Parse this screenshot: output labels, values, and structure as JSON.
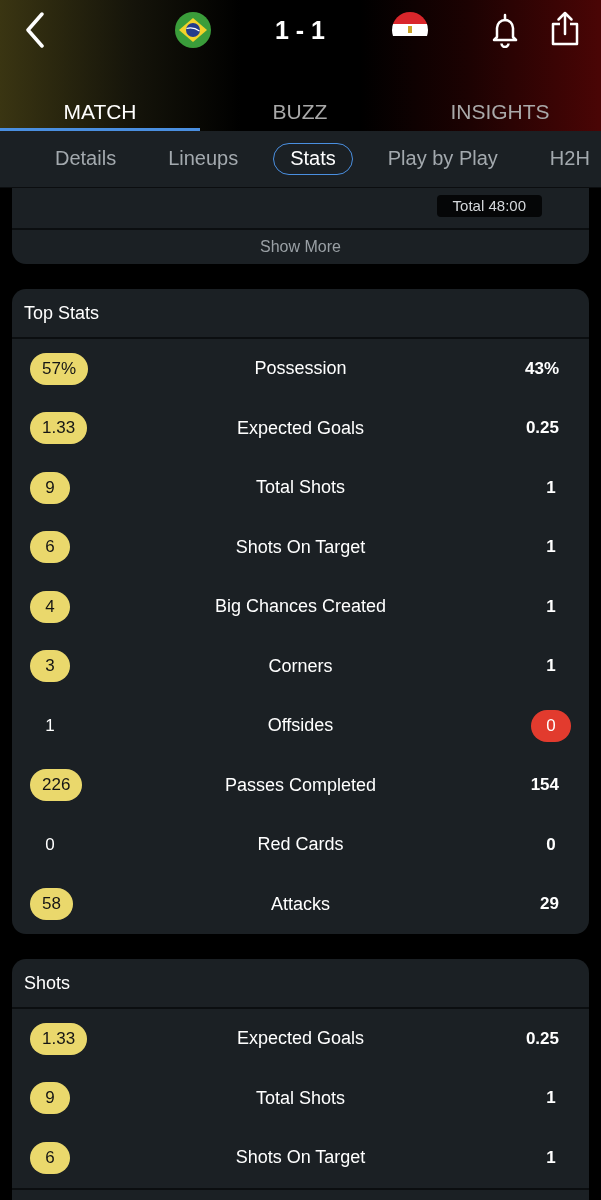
{
  "header": {
    "score": "1 - 1"
  },
  "tabs": [
    {
      "label": "MATCH",
      "selected": true
    },
    {
      "label": "BUZZ",
      "selected": false
    },
    {
      "label": "INSIGHTS",
      "selected": false
    }
  ],
  "subtabs": [
    {
      "label": "Details",
      "selected": false
    },
    {
      "label": "Lineups",
      "selected": false
    },
    {
      "label": "Stats",
      "selected": true
    },
    {
      "label": "Play by Play",
      "selected": false
    },
    {
      "label": "H2H",
      "selected": false
    }
  ],
  "timeline_card": {
    "total": "Total 48:00",
    "show_more": "Show More"
  },
  "sections": [
    {
      "title": "Top Stats",
      "rows": [
        {
          "label": "Possession",
          "home": {
            "value": "57%",
            "highlighted": true
          },
          "away": {
            "value": "43%",
            "highlighted": false
          }
        },
        {
          "label": "Expected Goals",
          "home": {
            "value": "1.33",
            "highlighted": true
          },
          "away": {
            "value": "0.25",
            "highlighted": false
          }
        },
        {
          "label": "Total Shots",
          "home": {
            "value": "9",
            "highlighted": true
          },
          "away": {
            "value": "1",
            "highlighted": false
          }
        },
        {
          "label": "Shots On Target",
          "home": {
            "value": "6",
            "highlighted": true
          },
          "away": {
            "value": "1",
            "highlighted": false
          }
        },
        {
          "label": "Big Chances Created",
          "home": {
            "value": "4",
            "highlighted": true
          },
          "away": {
            "value": "1",
            "highlighted": false
          }
        },
        {
          "label": "Corners",
          "home": {
            "value": "3",
            "highlighted": true
          },
          "away": {
            "value": "1",
            "highlighted": false
          }
        },
        {
          "label": "Offsides",
          "home": {
            "value": "1",
            "highlighted": false
          },
          "away": {
            "value": "0",
            "highlighted": true
          }
        },
        {
          "label": "Passes Completed",
          "home": {
            "value": "226",
            "highlighted": true
          },
          "away": {
            "value": "154",
            "highlighted": false
          }
        },
        {
          "label": "Red Cards",
          "home": {
            "value": "0",
            "highlighted": false
          },
          "away": {
            "value": "0",
            "highlighted": false
          }
        },
        {
          "label": "Attacks",
          "home": {
            "value": "58",
            "highlighted": true
          },
          "away": {
            "value": "29",
            "highlighted": false
          }
        }
      ]
    },
    {
      "title": "Shots",
      "rows": [
        {
          "label": "Expected Goals",
          "home": {
            "value": "1.33",
            "highlighted": true
          },
          "away": {
            "value": "0.25",
            "highlighted": false
          }
        },
        {
          "label": "Total Shots",
          "home": {
            "value": "9",
            "highlighted": true
          },
          "away": {
            "value": "1",
            "highlighted": false
          }
        },
        {
          "label": "Shots On Target",
          "home": {
            "value": "6",
            "highlighted": true
          },
          "away": {
            "value": "1",
            "highlighted": false
          }
        }
      ]
    }
  ]
}
